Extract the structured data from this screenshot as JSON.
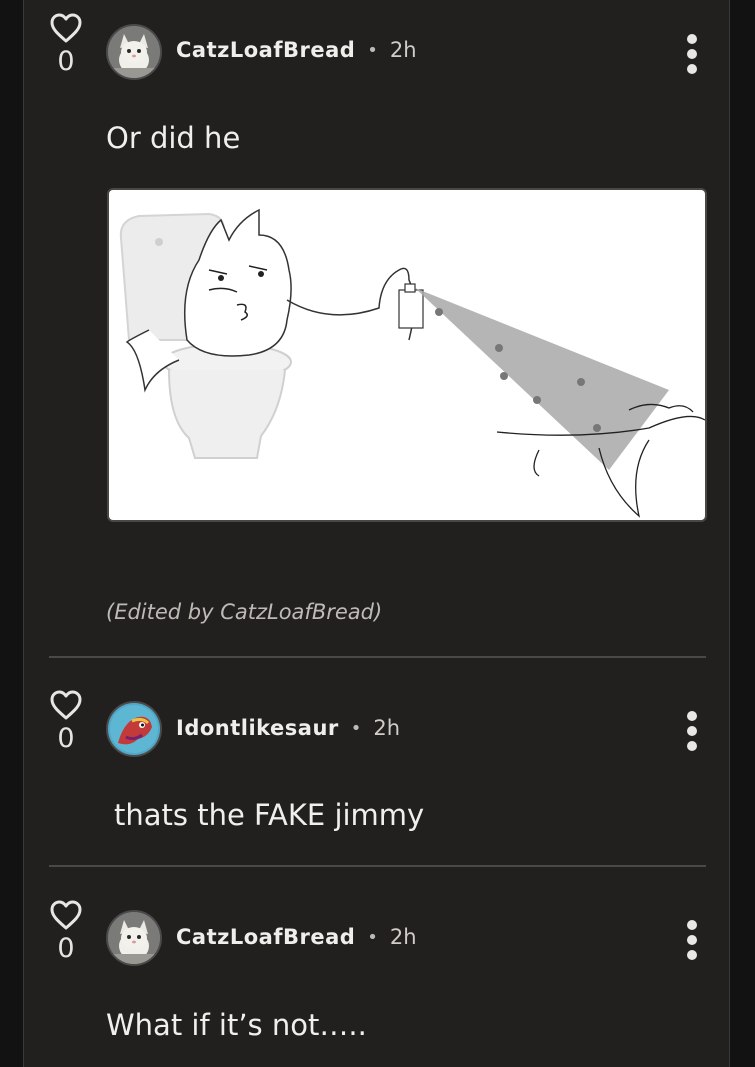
{
  "comments": [
    {
      "likes": "0",
      "author": "CatzLoafBread",
      "separator": "•",
      "time": "2h",
      "text": "Or did he",
      "edited_note": "(Edited by CatzLoafBread)",
      "image_label": "comic drawing of cat on toilet spraying bottle"
    },
    {
      "likes": "0",
      "author": "Idontlikesaur",
      "separator": "•",
      "time": "2h",
      "text": "thats the FAKE jimmy"
    },
    {
      "likes": "0",
      "author": "CatzLoafBread",
      "separator": "•",
      "time": "2h",
      "text": "What if it’s not….."
    }
  ],
  "colors": {
    "background": "#121212",
    "panel": "#221f1f",
    "divider": "#4b4848",
    "text": "#f0efec",
    "muted": "#bebbb6"
  },
  "icons": {
    "like": "heart-outline-icon",
    "menu": "kebab-menu-icon"
  }
}
